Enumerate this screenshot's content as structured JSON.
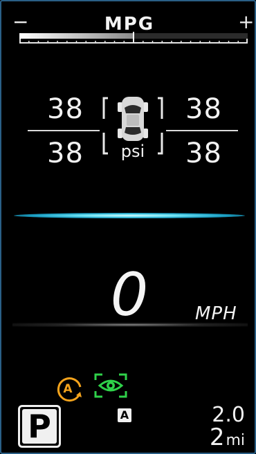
{
  "mpg": {
    "title": "MPG",
    "minus_label": "−",
    "plus_label": "+",
    "level_fraction": 0.5
  },
  "tire_pressure": {
    "front_left": "38",
    "front_right": "38",
    "rear_left": "38",
    "rear_right": "38",
    "unit": "psi"
  },
  "speed": {
    "value": "0",
    "unit": "MPH"
  },
  "indicators": {
    "auto_stop_start": "auto-stop-start-icon",
    "driver_monitoring": "driver-monitoring-eye-icon",
    "auto_badge": "A"
  },
  "gear": {
    "current": "P"
  },
  "trip": {
    "value": "2.0",
    "distance": "2",
    "distance_unit": "mi"
  },
  "colors": {
    "frame_border": "#2a5f86",
    "auto_stop": "#f4a31c",
    "eye_green": "#2fd24a",
    "glow_cyan": "#6fe3f4"
  }
}
